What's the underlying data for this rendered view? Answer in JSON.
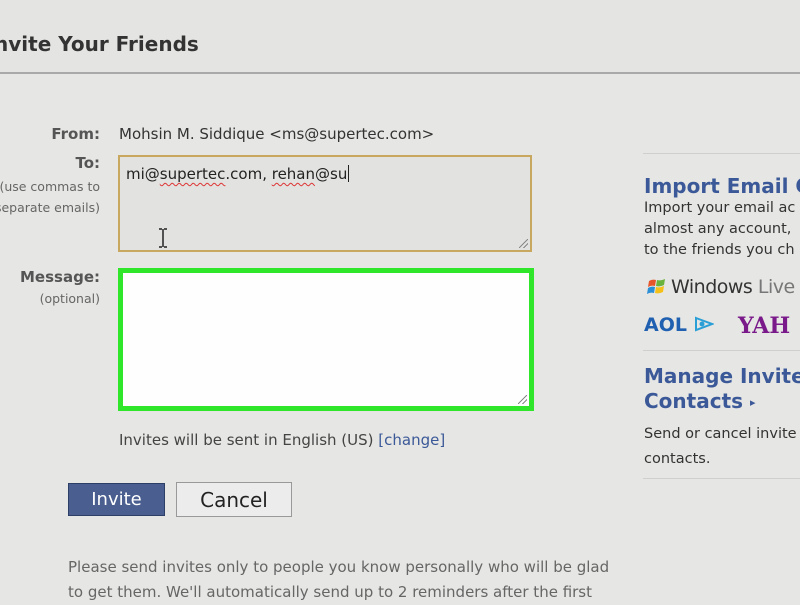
{
  "header": {
    "title": "nvite Your Friends"
  },
  "form": {
    "from_label": "From:",
    "from_value": "Mohsin M. Siddique <ms@supertec.com>",
    "to_label": "To:",
    "to_hint_1": "(use commas to",
    "to_hint_2": "separate emails)",
    "to_value_prefix": "mi@",
    "to_value_word1": "supertec",
    "to_value_mid": ".com, ",
    "to_value_word2": "rehan",
    "to_value_suffix": "@su",
    "message_label": "Message:",
    "message_hint": "(optional)",
    "message_value": "",
    "lang_note": "Invites will be sent in English (US) ",
    "lang_link": "[change]",
    "invite_button": "Invite",
    "cancel_button": "Cancel",
    "disclaimer": "Please send invites only to people you know personally who will be glad to get them. We'll automatically send up to 2 reminders after the first"
  },
  "sidebar": {
    "import_title": "Import Email C",
    "import_text_1": "Import your email ac",
    "import_text_2": "almost any account,",
    "import_text_3": "to the friends you ch",
    "provider_windows_1": "Windows",
    "provider_windows_2": "Live",
    "provider_aol": "AOL",
    "provider_yahoo": "YAH",
    "manage_title_1": "Manage Invite",
    "manage_title_2": "Contacts",
    "manage_text_1": "Send or cancel invite",
    "manage_text_2": "contacts."
  },
  "colors": {
    "link": "#3b5998",
    "highlight_border": "#2fe62a",
    "focus_border": "#c8a85e",
    "invite_button_bg": "#4a5f8f"
  }
}
